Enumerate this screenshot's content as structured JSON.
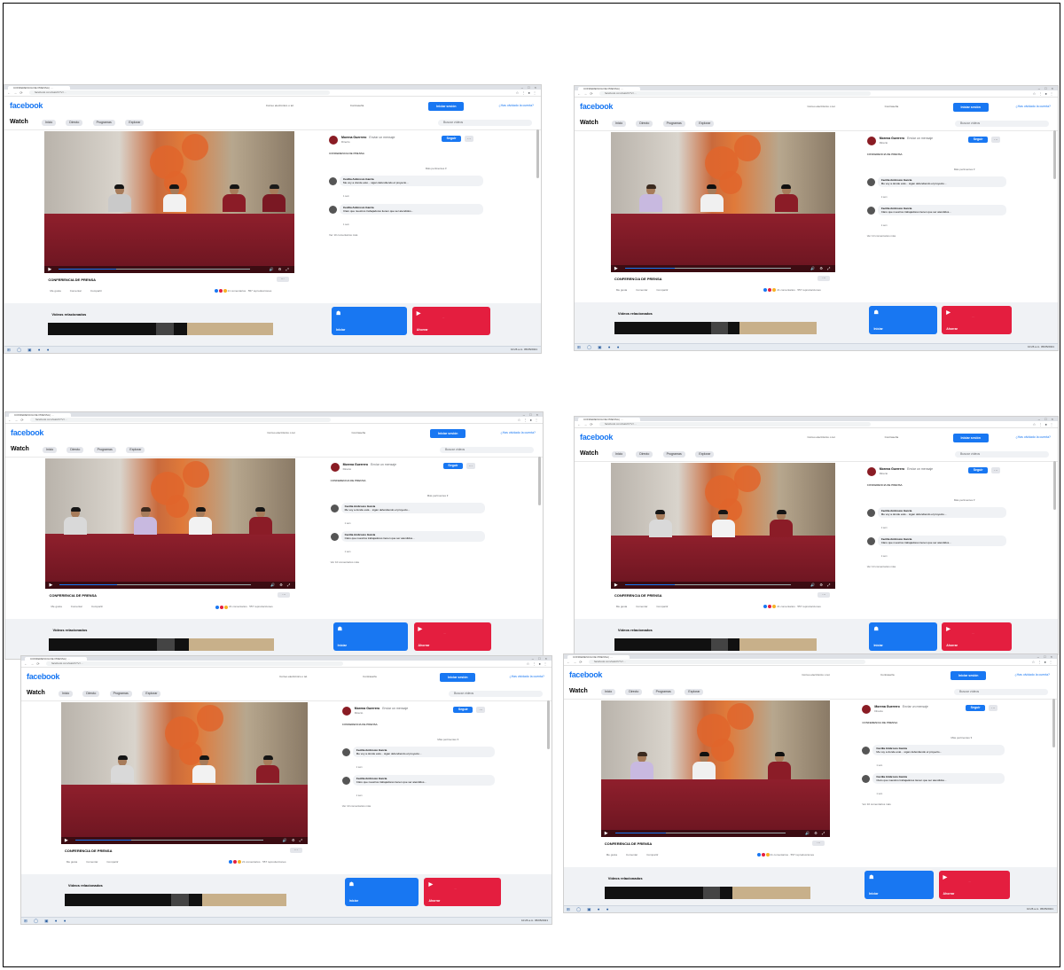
{
  "colors": {
    "facebook_blue": "#1877f2",
    "cta_red": "#e41e3f",
    "table_cloth": "#8f1f2c"
  },
  "browser": {
    "tab_title": "CONFERENCIA DE PRENSA | ...",
    "window_controls": "– □ ×",
    "nav_buttons": "← → ⟳",
    "url": "facebook.com/watch/?v=...",
    "extensions": "☆ ⋮ ● ⋮"
  },
  "facebook": {
    "logo": "facebook",
    "email_placeholder": "Correo electrónico o tel.",
    "password_placeholder": "Contraseña",
    "login_label": "Iniciar sesión",
    "forgot_link": "¿Has olvidado la cuenta?"
  },
  "watch": {
    "title": "Watch",
    "tabs": [
      "Inicio",
      "Directo",
      "Programas",
      "Explorar"
    ],
    "search_placeholder": "Buscar vídeos"
  },
  "video": {
    "title": "CONFERENCIA DE PRENSA",
    "more": "···",
    "play_icon": "▶",
    "control_icons": "🔊 ⚙ ⤢"
  },
  "post": {
    "page_name": "Morena Guerrero",
    "page_meta": "Enviar un mensaje",
    "page_sub": "Directo",
    "follow_label": "Seguir",
    "more": "···",
    "text": "CONFERENCIA DE PRENSA",
    "sort_label": "Más pertinentes ▾",
    "comments": [
      {
        "name": "Cecilia Ambrosio García",
        "text": "Me voy a donde esté... sigan defendiendo el proyecto...",
        "meta": "1 sem"
      },
      {
        "name": "Cecilia Ambrosio García",
        "text": "Claro que nuestros trabajadores tienen que ser atendidos...",
        "meta": "1 sem"
      }
    ],
    "more_comments": "Ver 10 comentarios más"
  },
  "actions": {
    "like": "Me gusta",
    "comment": "Comentar",
    "share": "Compartir",
    "stats": "21 comentarios · 557 reproducciones"
  },
  "bottom": {
    "related_title": "Vídeos relacionados",
    "login_cta": "Iniciar",
    "signup_cta": "Ahorrar",
    "cta_hint": "...",
    "login_icon": "☗",
    "signup_icon": "▶"
  },
  "taskbar": {
    "icons": "⊞ ◯ ▣ ● ●",
    "clock": "10:26 a.m. 05/05/2021"
  }
}
